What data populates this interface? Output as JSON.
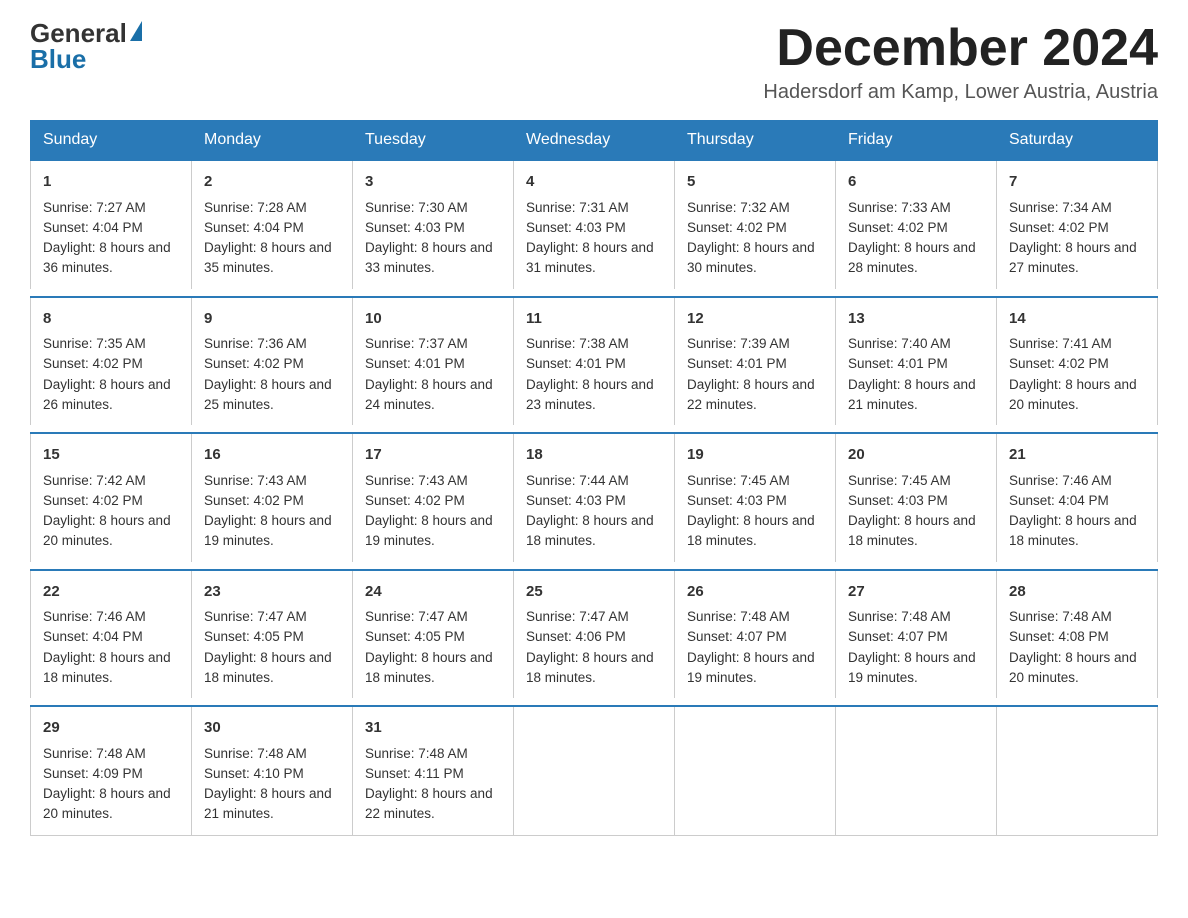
{
  "logo": {
    "general": "General",
    "blue": "Blue"
  },
  "header": {
    "month_year": "December 2024",
    "location": "Hadersdorf am Kamp, Lower Austria, Austria"
  },
  "days": {
    "headers": [
      "Sunday",
      "Monday",
      "Tuesday",
      "Wednesday",
      "Thursday",
      "Friday",
      "Saturday"
    ]
  },
  "weeks": [
    {
      "cells": [
        {
          "day": "1",
          "sunrise": "Sunrise: 7:27 AM",
          "sunset": "Sunset: 4:04 PM",
          "daylight": "Daylight: 8 hours and 36 minutes."
        },
        {
          "day": "2",
          "sunrise": "Sunrise: 7:28 AM",
          "sunset": "Sunset: 4:04 PM",
          "daylight": "Daylight: 8 hours and 35 minutes."
        },
        {
          "day": "3",
          "sunrise": "Sunrise: 7:30 AM",
          "sunset": "Sunset: 4:03 PM",
          "daylight": "Daylight: 8 hours and 33 minutes."
        },
        {
          "day": "4",
          "sunrise": "Sunrise: 7:31 AM",
          "sunset": "Sunset: 4:03 PM",
          "daylight": "Daylight: 8 hours and 31 minutes."
        },
        {
          "day": "5",
          "sunrise": "Sunrise: 7:32 AM",
          "sunset": "Sunset: 4:02 PM",
          "daylight": "Daylight: 8 hours and 30 minutes."
        },
        {
          "day": "6",
          "sunrise": "Sunrise: 7:33 AM",
          "sunset": "Sunset: 4:02 PM",
          "daylight": "Daylight: 8 hours and 28 minutes."
        },
        {
          "day": "7",
          "sunrise": "Sunrise: 7:34 AM",
          "sunset": "Sunset: 4:02 PM",
          "daylight": "Daylight: 8 hours and 27 minutes."
        }
      ]
    },
    {
      "cells": [
        {
          "day": "8",
          "sunrise": "Sunrise: 7:35 AM",
          "sunset": "Sunset: 4:02 PM",
          "daylight": "Daylight: 8 hours and 26 minutes."
        },
        {
          "day": "9",
          "sunrise": "Sunrise: 7:36 AM",
          "sunset": "Sunset: 4:02 PM",
          "daylight": "Daylight: 8 hours and 25 minutes."
        },
        {
          "day": "10",
          "sunrise": "Sunrise: 7:37 AM",
          "sunset": "Sunset: 4:01 PM",
          "daylight": "Daylight: 8 hours and 24 minutes."
        },
        {
          "day": "11",
          "sunrise": "Sunrise: 7:38 AM",
          "sunset": "Sunset: 4:01 PM",
          "daylight": "Daylight: 8 hours and 23 minutes."
        },
        {
          "day": "12",
          "sunrise": "Sunrise: 7:39 AM",
          "sunset": "Sunset: 4:01 PM",
          "daylight": "Daylight: 8 hours and 22 minutes."
        },
        {
          "day": "13",
          "sunrise": "Sunrise: 7:40 AM",
          "sunset": "Sunset: 4:01 PM",
          "daylight": "Daylight: 8 hours and 21 minutes."
        },
        {
          "day": "14",
          "sunrise": "Sunrise: 7:41 AM",
          "sunset": "Sunset: 4:02 PM",
          "daylight": "Daylight: 8 hours and 20 minutes."
        }
      ]
    },
    {
      "cells": [
        {
          "day": "15",
          "sunrise": "Sunrise: 7:42 AM",
          "sunset": "Sunset: 4:02 PM",
          "daylight": "Daylight: 8 hours and 20 minutes."
        },
        {
          "day": "16",
          "sunrise": "Sunrise: 7:43 AM",
          "sunset": "Sunset: 4:02 PM",
          "daylight": "Daylight: 8 hours and 19 minutes."
        },
        {
          "day": "17",
          "sunrise": "Sunrise: 7:43 AM",
          "sunset": "Sunset: 4:02 PM",
          "daylight": "Daylight: 8 hours and 19 minutes."
        },
        {
          "day": "18",
          "sunrise": "Sunrise: 7:44 AM",
          "sunset": "Sunset: 4:03 PM",
          "daylight": "Daylight: 8 hours and 18 minutes."
        },
        {
          "day": "19",
          "sunrise": "Sunrise: 7:45 AM",
          "sunset": "Sunset: 4:03 PM",
          "daylight": "Daylight: 8 hours and 18 minutes."
        },
        {
          "day": "20",
          "sunrise": "Sunrise: 7:45 AM",
          "sunset": "Sunset: 4:03 PM",
          "daylight": "Daylight: 8 hours and 18 minutes."
        },
        {
          "day": "21",
          "sunrise": "Sunrise: 7:46 AM",
          "sunset": "Sunset: 4:04 PM",
          "daylight": "Daylight: 8 hours and 18 minutes."
        }
      ]
    },
    {
      "cells": [
        {
          "day": "22",
          "sunrise": "Sunrise: 7:46 AM",
          "sunset": "Sunset: 4:04 PM",
          "daylight": "Daylight: 8 hours and 18 minutes."
        },
        {
          "day": "23",
          "sunrise": "Sunrise: 7:47 AM",
          "sunset": "Sunset: 4:05 PM",
          "daylight": "Daylight: 8 hours and 18 minutes."
        },
        {
          "day": "24",
          "sunrise": "Sunrise: 7:47 AM",
          "sunset": "Sunset: 4:05 PM",
          "daylight": "Daylight: 8 hours and 18 minutes."
        },
        {
          "day": "25",
          "sunrise": "Sunrise: 7:47 AM",
          "sunset": "Sunset: 4:06 PM",
          "daylight": "Daylight: 8 hours and 18 minutes."
        },
        {
          "day": "26",
          "sunrise": "Sunrise: 7:48 AM",
          "sunset": "Sunset: 4:07 PM",
          "daylight": "Daylight: 8 hours and 19 minutes."
        },
        {
          "day": "27",
          "sunrise": "Sunrise: 7:48 AM",
          "sunset": "Sunset: 4:07 PM",
          "daylight": "Daylight: 8 hours and 19 minutes."
        },
        {
          "day": "28",
          "sunrise": "Sunrise: 7:48 AM",
          "sunset": "Sunset: 4:08 PM",
          "daylight": "Daylight: 8 hours and 20 minutes."
        }
      ]
    },
    {
      "cells": [
        {
          "day": "29",
          "sunrise": "Sunrise: 7:48 AM",
          "sunset": "Sunset: 4:09 PM",
          "daylight": "Daylight: 8 hours and 20 minutes."
        },
        {
          "day": "30",
          "sunrise": "Sunrise: 7:48 AM",
          "sunset": "Sunset: 4:10 PM",
          "daylight": "Daylight: 8 hours and 21 minutes."
        },
        {
          "day": "31",
          "sunrise": "Sunrise: 7:48 AM",
          "sunset": "Sunset: 4:11 PM",
          "daylight": "Daylight: 8 hours and 22 minutes."
        },
        null,
        null,
        null,
        null
      ]
    }
  ]
}
